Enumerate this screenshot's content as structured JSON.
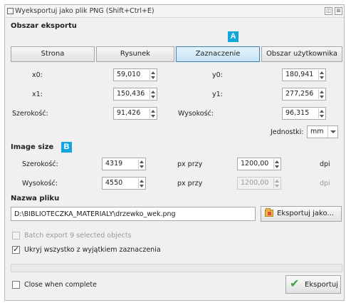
{
  "window": {
    "title": "Wyeksportuj jako plik PNG (Shift+Ctrl+E)",
    "btn_detach": "◫",
    "btn_close": "⊠"
  },
  "export_area": {
    "section_label": "Obszar eksportu",
    "tabs": [
      "Strona",
      "Rysunek",
      "Zaznaczenie",
      "Obszar użytkownika"
    ],
    "active_tab": "Zaznaczenie",
    "badge": "A",
    "fields": {
      "x0_label": "x0:",
      "x0_value": "59,010",
      "y0_label": "y0:",
      "y0_value": "180,941",
      "x1_label": "x1:",
      "x1_value": "150,436",
      "y1_label": "y1:",
      "y1_value": "277,256",
      "width_label": "Szerokość:",
      "width_value": "91,426",
      "height_label": "Wysokość:",
      "height_value": "96,315"
    },
    "units_label": "Jednostki:",
    "units_value": "mm"
  },
  "image_size": {
    "section_label": "Image size",
    "badge": "B",
    "width_label": "Szerokość:",
    "width_value": "4319",
    "px_at_1": "px przy",
    "dpi_1_value": "1200,00",
    "dpi_1_unit": "dpi",
    "height_label": "Wysokość:",
    "height_value": "4550",
    "px_at_2": "px przy",
    "dpi_2_value": "1200,00",
    "dpi_2_unit": "dpi"
  },
  "filename": {
    "section_label": "Nazwa pliku",
    "value": "D:\\BIBLIOTECZKA_MATERIALY\\drzewko_wek.png",
    "export_as_label": "Eksportuj jako..."
  },
  "options": {
    "batch_label": "Batch export 9 selected objects",
    "batch_checked": false,
    "hide_label": "Ukryj wszystko z wyjątkiem zaznaczenia",
    "hide_checked": true,
    "progress": 0
  },
  "footer": {
    "close_when_complete_label": "Close when complete",
    "close_checked": false,
    "export_label": "Eksportuj"
  },
  "colors": {
    "badge": "#12a6df",
    "active_tab": "#c7e4f7",
    "export_check": "#43a33a"
  }
}
